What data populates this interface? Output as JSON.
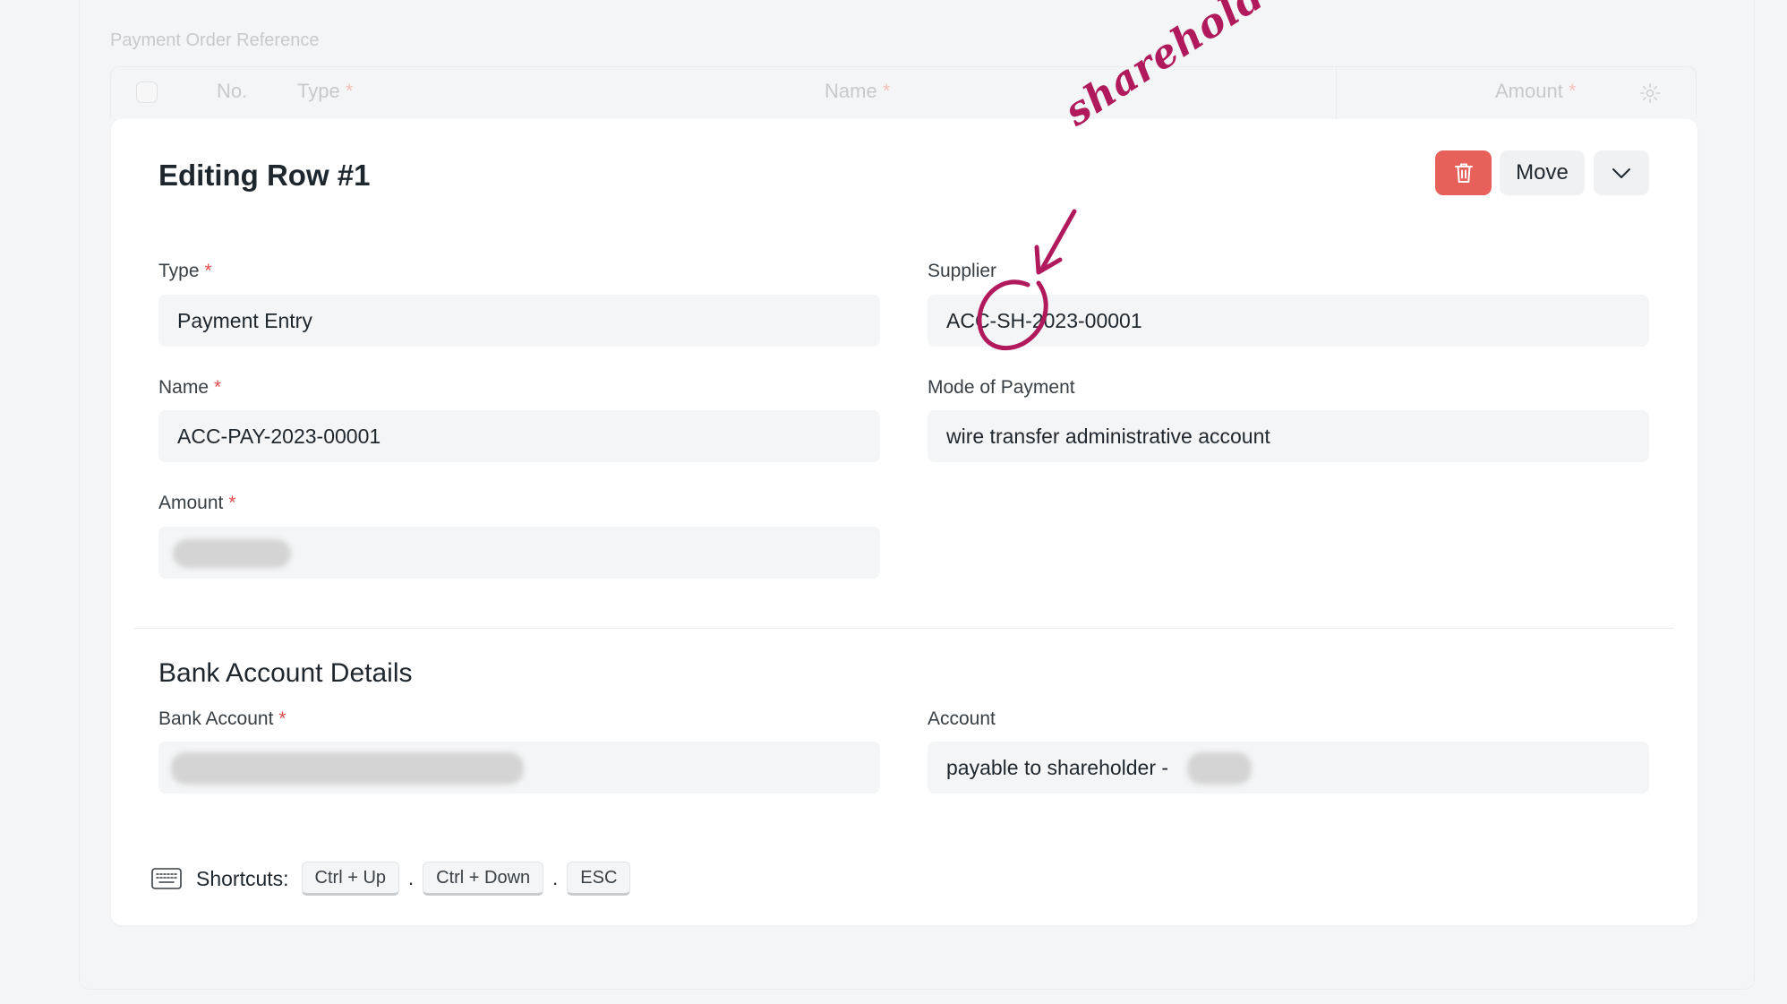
{
  "section_label": "Payment Order Reference",
  "grid": {
    "columns": {
      "no": "No.",
      "type": "Type",
      "name": "Name",
      "amount": "Amount"
    },
    "required_mark": "*"
  },
  "editor": {
    "title": "Editing Row #1",
    "move_label": "Move",
    "required_mark": "*",
    "fields": {
      "type": {
        "label": "Type",
        "value": "Payment Entry"
      },
      "supplier": {
        "label": "Supplier",
        "value": "ACC-SH-2023-00001"
      },
      "name": {
        "label": "Name",
        "value": "ACC-PAY-2023-00001"
      },
      "mode_of_payment": {
        "label": "Mode of Payment",
        "value": "wire transfer administrative account"
      },
      "amount": {
        "label": "Amount"
      }
    },
    "bank_section": {
      "title": "Bank Account Details",
      "bank_account": {
        "label": "Bank Account"
      },
      "account": {
        "label": "Account",
        "value": "payable to shareholder -"
      }
    },
    "shortcuts": {
      "label": "Shortcuts:",
      "keys": [
        "Ctrl + Up",
        "Ctrl + Down",
        "ESC"
      ],
      "separator": "."
    }
  },
  "annotation": {
    "text": "shareholder",
    "color": "#b01a5c"
  },
  "colors": {
    "danger": "#e8605a",
    "required": "#e24c4c",
    "page_bg": "#f4f5f6"
  }
}
